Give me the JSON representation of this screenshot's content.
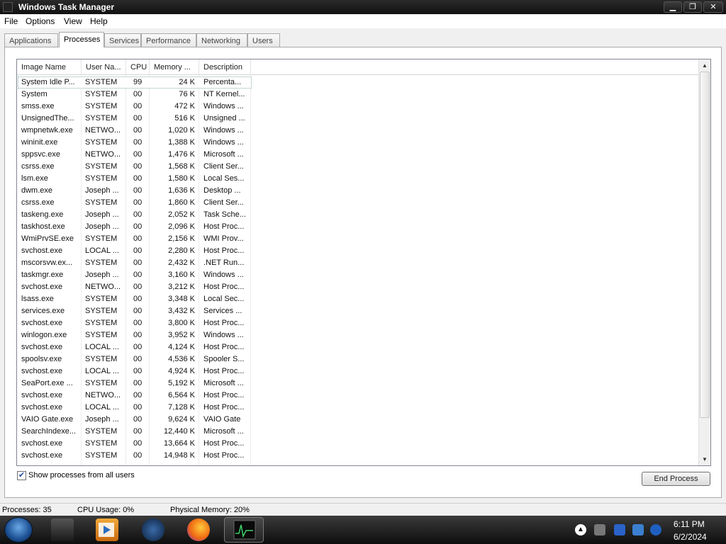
{
  "window": {
    "title": "Windows Task Manager"
  },
  "menu": [
    "File",
    "Options",
    "View",
    "Help"
  ],
  "tabs": [
    "Applications",
    "Processes",
    "Services",
    "Performance",
    "Networking",
    "Users"
  ],
  "active_tab": "Processes",
  "columns": [
    "Image Name",
    "User Na...",
    "CPU",
    "Memory ...",
    "Description"
  ],
  "rows": [
    [
      "System Idle P...",
      "SYSTEM",
      "99",
      "24 K",
      "Percenta..."
    ],
    [
      "System",
      "SYSTEM",
      "00",
      "76 K",
      "NT Kernel..."
    ],
    [
      "smss.exe",
      "SYSTEM",
      "00",
      "472 K",
      "Windows ..."
    ],
    [
      "UnsignedThe...",
      "SYSTEM",
      "00",
      "516 K",
      "Unsigned ..."
    ],
    [
      "wmpnetwk.exe",
      "NETWO...",
      "00",
      "1,020 K",
      "Windows ..."
    ],
    [
      "wininit.exe",
      "SYSTEM",
      "00",
      "1,388 K",
      "Windows ..."
    ],
    [
      "sppsvc.exe",
      "NETWO...",
      "00",
      "1,476 K",
      "Microsoft ..."
    ],
    [
      "csrss.exe",
      "SYSTEM",
      "00",
      "1,568 K",
      "Client Ser..."
    ],
    [
      "lsm.exe",
      "SYSTEM",
      "00",
      "1,580 K",
      "Local Ses..."
    ],
    [
      "dwm.exe",
      "Joseph ...",
      "00",
      "1,636 K",
      "Desktop ..."
    ],
    [
      "csrss.exe",
      "SYSTEM",
      "00",
      "1,860 K",
      "Client Ser..."
    ],
    [
      "taskeng.exe",
      "Joseph ...",
      "00",
      "2,052 K",
      "Task Sche..."
    ],
    [
      "taskhost.exe",
      "Joseph ...",
      "00",
      "2,096 K",
      "Host Proc..."
    ],
    [
      "WmiPrvSE.exe",
      "SYSTEM",
      "00",
      "2,156 K",
      "WMI Prov..."
    ],
    [
      "svchost.exe",
      "LOCAL ...",
      "00",
      "2,280 K",
      "Host Proc..."
    ],
    [
      "mscorsvw.ex...",
      "SYSTEM",
      "00",
      "2,432 K",
      ".NET Run..."
    ],
    [
      "taskmgr.exe",
      "Joseph ...",
      "00",
      "3,160 K",
      "Windows ..."
    ],
    [
      "svchost.exe",
      "NETWO...",
      "00",
      "3,212 K",
      "Host Proc..."
    ],
    [
      "lsass.exe",
      "SYSTEM",
      "00",
      "3,348 K",
      "Local Sec..."
    ],
    [
      "services.exe",
      "SYSTEM",
      "00",
      "3,432 K",
      "Services ..."
    ],
    [
      "svchost.exe",
      "SYSTEM",
      "00",
      "3,800 K",
      "Host Proc..."
    ],
    [
      "winlogon.exe",
      "SYSTEM",
      "00",
      "3,952 K",
      "Windows ..."
    ],
    [
      "svchost.exe",
      "LOCAL ...",
      "00",
      "4,124 K",
      "Host Proc..."
    ],
    [
      "spoolsv.exe",
      "SYSTEM",
      "00",
      "4,536 K",
      "Spooler S..."
    ],
    [
      "svchost.exe",
      "LOCAL ...",
      "00",
      "4,924 K",
      "Host Proc..."
    ],
    [
      "SeaPort.exe ...",
      "SYSTEM",
      "00",
      "5,192 K",
      "Microsoft ..."
    ],
    [
      "svchost.exe",
      "NETWO...",
      "00",
      "6,564 K",
      "Host Proc..."
    ],
    [
      "svchost.exe",
      "LOCAL ...",
      "00",
      "7,128 K",
      "Host Proc..."
    ],
    [
      "VAIO Gate.exe",
      "Joseph ...",
      "00",
      "9,624 K",
      "VAIO Gate"
    ],
    [
      "SearchIndexe...",
      "SYSTEM",
      "00",
      "12,440 K",
      "Microsoft ..."
    ],
    [
      "svchost.exe",
      "SYSTEM",
      "00",
      "13,664 K",
      "Host Proc..."
    ],
    [
      "svchost.exe",
      "SYSTEM",
      "00",
      "14,948 K",
      "Host Proc..."
    ]
  ],
  "show_all_users": {
    "label": "Show processes from all users",
    "checked": true
  },
  "end_process_label": "End Process",
  "status": {
    "processes": "Processes: 35",
    "cpu": "CPU Usage: 0%",
    "memory": "Physical Memory: 20%"
  },
  "clock": {
    "time": "6:11 PM",
    "date": "6/2/2024"
  },
  "taskbar_icons": [
    "start-orb-icon",
    "folder-icon",
    "media-player-icon",
    "network-globe-icon",
    "firefox-icon",
    "task-manager-icon"
  ],
  "tray_icons": [
    "show-hidden-icons",
    "battery-icon",
    "security-shield-icon",
    "display-icon",
    "network-icon"
  ],
  "colors": {
    "titlebar": "#111111",
    "taskbar": "#1a1a1a",
    "accent": "#1c4a9c"
  }
}
